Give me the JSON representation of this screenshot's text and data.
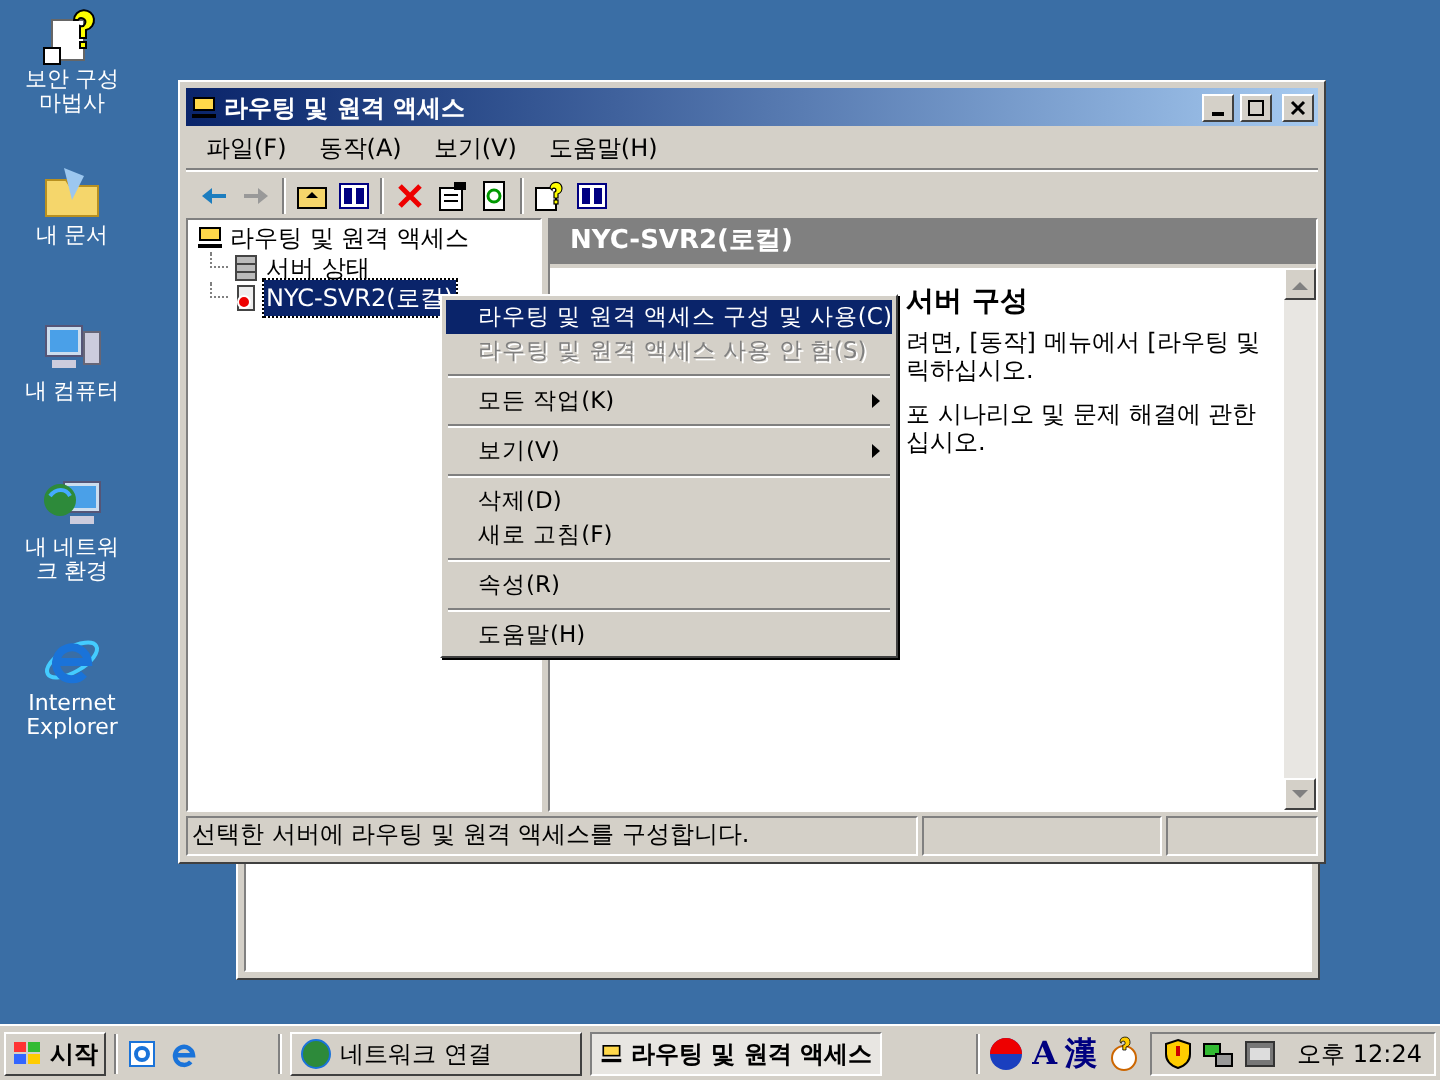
{
  "desktop_icons": [
    {
      "kind": "wizard",
      "label": "보안 구성 마법사"
    },
    {
      "kind": "documents",
      "label": "내 문서"
    },
    {
      "kind": "computer",
      "label": "내 컴퓨터"
    },
    {
      "kind": "network",
      "label": "내 네트워크 환경"
    },
    {
      "kind": "ie",
      "label": "Internet Explorer"
    }
  ],
  "window": {
    "title": "라우팅 및 원격 액세스",
    "menu": [
      "파일(F)",
      "동작(A)",
      "보기(V)",
      "도움말(H)"
    ],
    "tree": {
      "label": "라우팅 및 원격 액세스",
      "children": [
        {
          "label": "서버 상태",
          "kind": "servers",
          "selected": false
        },
        {
          "label": "NYC-SVR2(로컬)",
          "kind": "server",
          "selected": true
        }
      ]
    },
    "pane_header": "NYC-SVR2(로컬)",
    "content_heading": "서버 구성",
    "content_lines": [
      "려면, [동작] 메뉴에서 [라우팅 및",
      "릭하십시오.",
      "포 시나리오 및 문제 해결에 관한",
      "십시오."
    ],
    "status_bar": "선택한 서버에 라우팅 및 원격 액세스를 구성합니다."
  },
  "context_menu": [
    {
      "kind": "item",
      "label": "라우팅 및 원격 액세스 구성 및 사용(C)",
      "selected": true,
      "disabled": false,
      "submenu": false
    },
    {
      "kind": "item",
      "label": "라우팅 및 원격 액세스 사용 안 함(S)",
      "selected": false,
      "disabled": true,
      "submenu": false
    },
    {
      "kind": "separator"
    },
    {
      "kind": "item",
      "label": "모든 작업(K)",
      "selected": false,
      "disabled": false,
      "submenu": true
    },
    {
      "kind": "separator"
    },
    {
      "kind": "item",
      "label": "보기(V)",
      "selected": false,
      "disabled": false,
      "submenu": true
    },
    {
      "kind": "separator"
    },
    {
      "kind": "item",
      "label": "삭제(D)",
      "selected": false,
      "disabled": false,
      "submenu": false
    },
    {
      "kind": "item",
      "label": "새로 고침(F)",
      "selected": false,
      "disabled": false,
      "submenu": false
    },
    {
      "kind": "separator"
    },
    {
      "kind": "item",
      "label": "속성(R)",
      "selected": false,
      "disabled": false,
      "submenu": false
    },
    {
      "kind": "separator"
    },
    {
      "kind": "item",
      "label": "도움말(H)",
      "selected": false,
      "disabled": false,
      "submenu": false
    }
  ],
  "taskbar": {
    "start": "시작",
    "tasks": [
      {
        "kind": "network",
        "label": "네트워크 연결",
        "selected": false
      },
      {
        "kind": "rras",
        "label": "라우팅 및 원격 액세스",
        "selected": true
      }
    ],
    "ime": [
      "A",
      "漢"
    ],
    "clock": "오후 12:24"
  }
}
